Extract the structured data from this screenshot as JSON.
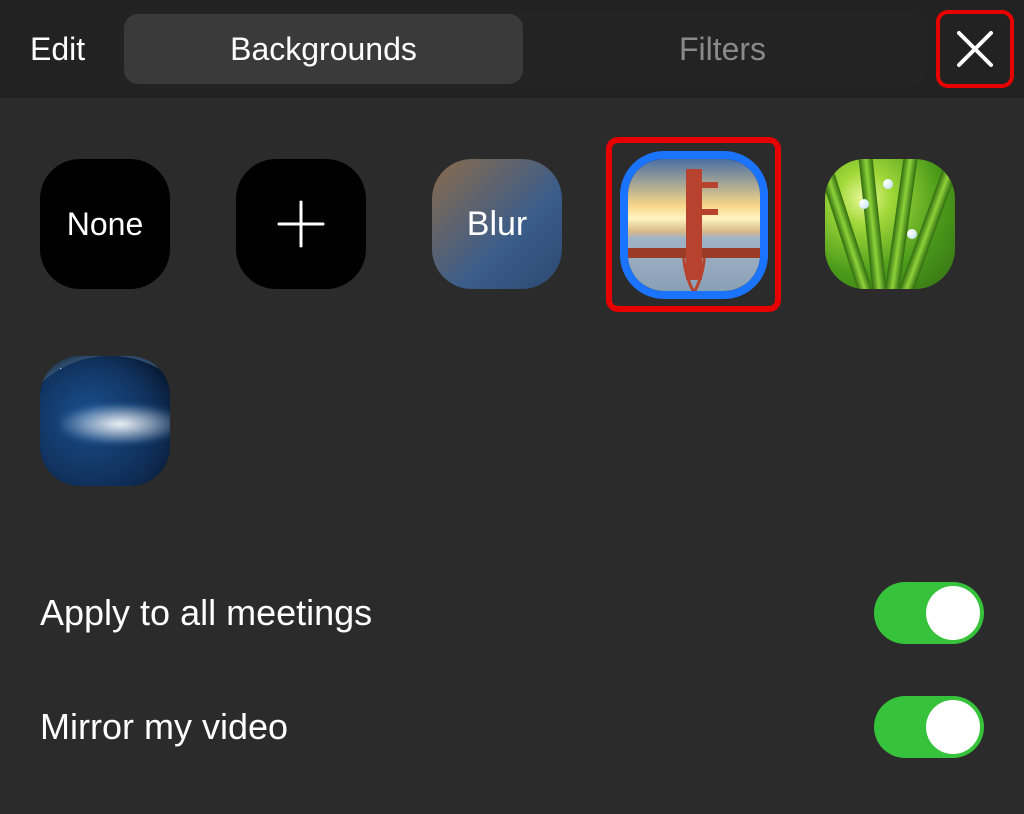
{
  "header": {
    "edit_label": "Edit",
    "tabs": {
      "backgrounds": "Backgrounds",
      "filters": "Filters",
      "active": "backgrounds"
    },
    "close_highlighted": true
  },
  "backgrounds": {
    "none_label": "None",
    "add_icon": "plus-icon",
    "blur_label": "Blur",
    "items": [
      {
        "id": "none",
        "type": "none",
        "label": "None",
        "selected": false
      },
      {
        "id": "add",
        "type": "add",
        "selected": false
      },
      {
        "id": "blur",
        "type": "blur",
        "label": "Blur",
        "selected": false
      },
      {
        "id": "bridge",
        "type": "image",
        "description": "Golden Gate Bridge at sunset",
        "selected": true,
        "highlighted": true
      },
      {
        "id": "grass",
        "type": "image",
        "description": "Green grass with dew drops",
        "selected": false
      },
      {
        "id": "space",
        "type": "image",
        "description": "Earth from space with sunrise glow",
        "selected": false
      }
    ]
  },
  "settings": {
    "apply_all": {
      "label": "Apply to all meetings",
      "value": true
    },
    "mirror": {
      "label": "Mirror my video",
      "value": true
    }
  },
  "colors": {
    "highlight_red": "#e60000",
    "selection_blue": "#1a74ff",
    "toggle_green": "#36c23a",
    "bg": "#2b2b2b"
  }
}
